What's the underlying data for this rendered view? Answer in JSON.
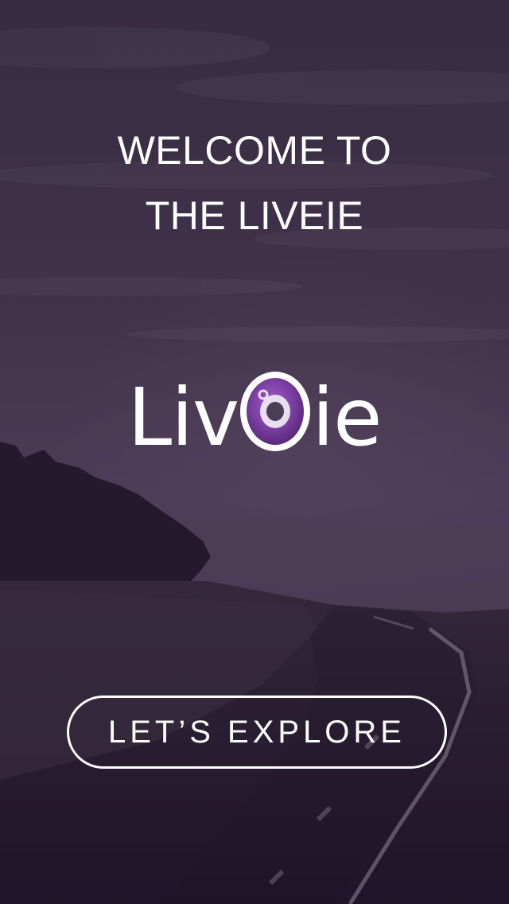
{
  "welcome": {
    "line1": "WELCOME TO",
    "line2": "THE LIVEIE"
  },
  "logo": {
    "text_left": "Liv",
    "text_right": "ie",
    "mark_icon": "camera-lens-icon",
    "accent_color": "#7a3fa0"
  },
  "cta": {
    "label": "LET’S EXPLORE"
  }
}
